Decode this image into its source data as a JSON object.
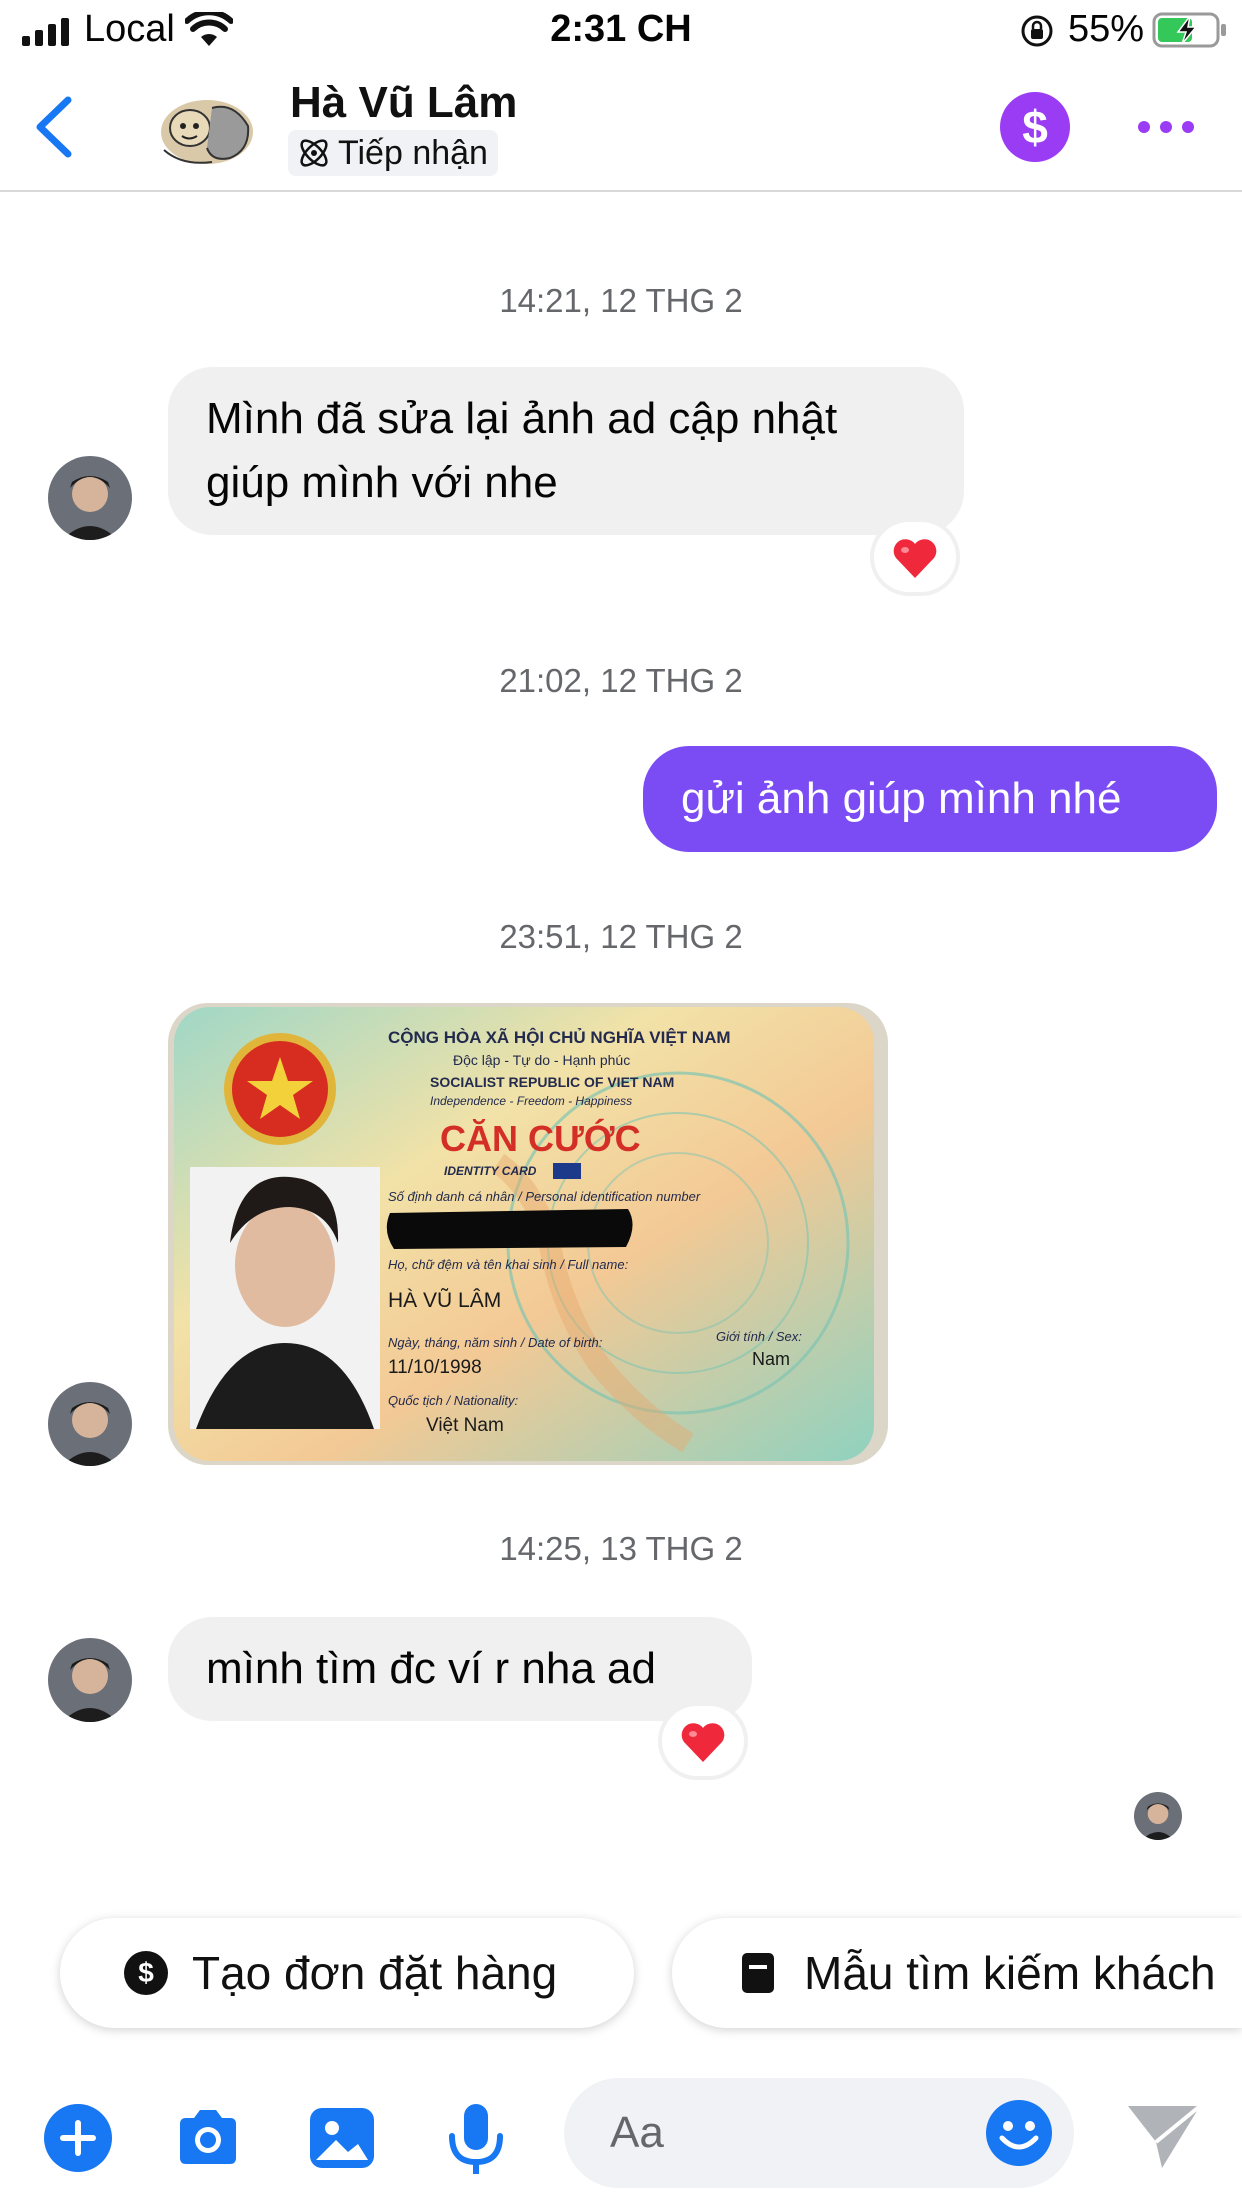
{
  "status_bar": {
    "carrier": "Local",
    "time": "2:31 CH",
    "battery": "55%"
  },
  "header": {
    "name": "Hà Vũ Lâm",
    "label": "Tiếp nhận"
  },
  "messages": [
    {
      "timestamp": "14:21, 12 THG 2",
      "text_line1": "Mình đã sửa lại ảnh ad cập nhật",
      "text_line2": "giúp mình với nhe"
    },
    {
      "timestamp": "21:02, 12 THG 2",
      "text": "gửi ảnh giúp mình nhé"
    },
    {
      "timestamp": "23:51, 12 THG 2"
    },
    {
      "timestamp": "14:25, 13 THG 2",
      "text": "mình tìm đc ví r nha ad"
    }
  ],
  "id_card": {
    "line1": "CỘNG HÒA XÃ HỘI CHỦ NGHĨA VIỆT NAM",
    "line2": "Độc lập - Tự do - Hạnh phúc",
    "line3": "SOCIALIST REPUBLIC OF VIET NAM",
    "line4": "Independence - Freedom - Happiness",
    "title": "CĂN CƯỚC",
    "subtitle": "IDENTITY CARD",
    "id_label": "Số định danh cá nhân / Personal identification number",
    "name_label": "Họ, chữ đệm và tên khai sinh / Full name:",
    "name": "HÀ VŨ LÂM",
    "dob_label": "Ngày, tháng, năm sinh / Date of birth:",
    "dob": "11/10/1998",
    "sex_label": "Giới tính / Sex:",
    "sex": "Nam",
    "nationality_label": "Quốc tịch / Nationality:",
    "nationality": "Việt Nam"
  },
  "quick_replies": [
    "Tạo đơn đặt hàng",
    "Mẫu tìm kiếm khách"
  ],
  "composer": {
    "placeholder": "Aa"
  },
  "colors": {
    "accent_blue": "#1877f2",
    "outgoing_bubble": "#7b4cf4",
    "dollar_button": "#9b3cf5",
    "reaction_heart": "#f0283c"
  },
  "icons": [
    "signal-icon",
    "wifi-icon",
    "orientation-lock-icon",
    "battery-icon",
    "back-chevron-icon",
    "label-icon",
    "dollar-icon",
    "more-icon",
    "heart-icon",
    "plus-icon",
    "camera-icon",
    "gallery-icon",
    "microphone-icon",
    "emoji-icon",
    "send-icon"
  ]
}
